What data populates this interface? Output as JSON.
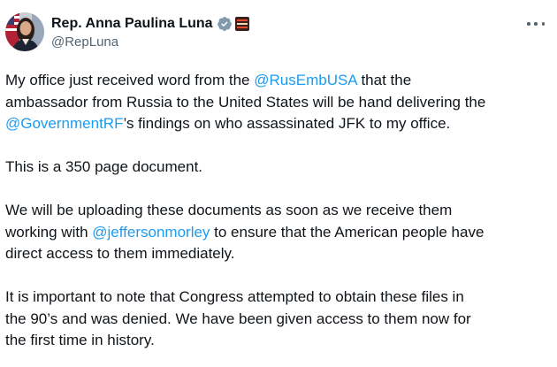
{
  "author": {
    "display_name": "Rep. Anna Paulina Luna",
    "handle": "@RepLuna",
    "verified_icon": "verified-badge-gray",
    "affiliate_icon": "affiliate-badge"
  },
  "colors": {
    "text": "#0f1419",
    "secondary": "#536471",
    "link": "#1d9bf0",
    "verified": "#829aab"
  },
  "post": {
    "p1": {
      "l1_a": "My office just received word from the ",
      "l1_mention": "@RusEmbUSA",
      "l1_b": " that the",
      "l2": "ambassador from Russia to the United States will be hand delivering the",
      "l3_mention": "@GovernmentRF",
      "l3_b": "’s findings on who assassinated JFK to my office."
    },
    "p2": {
      "l1": "This is a 350 page document."
    },
    "p3": {
      "l1": "We will be uploading these documents as soon as we receive them",
      "l2_a": "working with ",
      "l2_mention": "@jeffersonmorley",
      "l2_b": " to ensure that the American people have",
      "l3": "direct access to them immediately."
    },
    "p4": {
      "l1": "It is important to note that Congress attempted to obtain these files in",
      "l2": "the 90’s and was denied.  We have been given access to them now for",
      "l3": "the first time in history."
    }
  }
}
